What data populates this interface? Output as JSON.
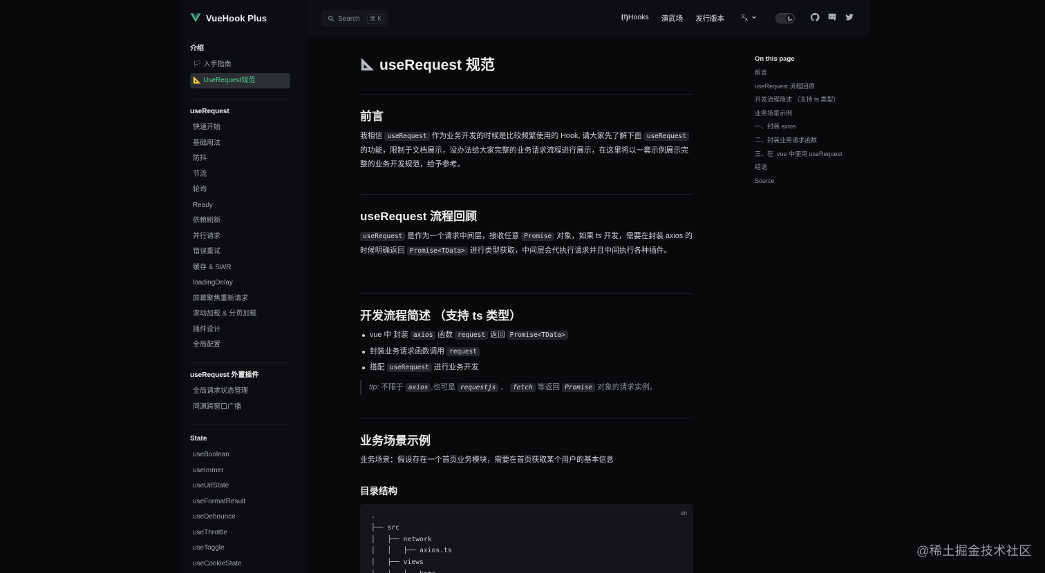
{
  "navbar": {
    "title": "VueHook Plus",
    "search_label": "Search",
    "search_kbd": "⌘ K",
    "links": [
      "⦗f⦘Hooks",
      "演武场",
      "发行版本"
    ],
    "lang_icon": "translate-icon",
    "icons": [
      "github-icon",
      "discord-icon",
      "twitter-icon"
    ]
  },
  "sidebar": {
    "groups": [
      {
        "title": "介绍",
        "items": [
          "🏳 入手指南",
          "📐 UseRequest规范"
        ]
      },
      {
        "title": "useRequest",
        "items": [
          "快速开始",
          "基础用法",
          "防抖",
          "节流",
          "轮询",
          "Ready",
          "依赖刷新",
          "并行请求",
          "错误重试",
          "缓存 & SWR",
          "loadingDelay",
          "屏幕聚焦重新请求",
          "滚动加载 & 分页加载",
          "插件设计",
          "全局配置"
        ]
      },
      {
        "title": "useRequest 外置插件",
        "items": [
          "全局请求状态管理",
          "同源跨窗口广播"
        ]
      },
      {
        "title": "State",
        "items": [
          "useBoolean",
          "useImmer",
          "useUrlState",
          "useFormatResult",
          "useDebounce",
          "useThrottle",
          "useToggle",
          "useCookieState"
        ]
      }
    ],
    "active_item": "📐 UseRequest规范"
  },
  "content": {
    "title": "useRequest 规范",
    "title_icon": "triangular-ruler-icon",
    "sections": {
      "s1_title": "前言",
      "s1_p": [
        "我相信 ",
        "useRequest",
        " 作为业务开发的时候是比较频繁使用的 Hook, 请大家先了解下面 ",
        "useRequest",
        " 的功能，限制于文档展示，没办法给大家完整的业务请求流程进行展示，在这里将以一套示例展示完整的业务开发规范，给予参考。"
      ],
      "s2_title": "useRequest 流程回顾",
      "s2_p": [
        "useRequest",
        " 是作为一个请求中间层，接收任意 ",
        "Promise",
        " 对象，如果 ts 开发，需要在封装 axios 的时候明确返回 ",
        "Promise<TData>",
        " 进行类型获取，中间层会代执行请求并且中间执行各种插件。"
      ],
      "s3_title": "开发流程简述 （支持 ts 类型）",
      "s3_list": [
        [
          "vue 中 封装 ",
          "axios",
          " 函数 ",
          "request",
          " 返回 ",
          "Promise<TData>"
        ],
        [
          "封装业务请求函数调用 ",
          "request"
        ],
        [
          "搭配 ",
          "useRequest",
          " 进行业务开发"
        ]
      ],
      "tip": [
        "tip:",
        " 不限于 ",
        "axios",
        ",也可是 ",
        "requestjs",
        " 、 ",
        "fetch",
        " 等返回 ",
        "Promise",
        " 对象的请求实例。"
      ],
      "s4_title": "业务场景示例",
      "s4_p": "业务场景：假设存在一个首页业务模块，需要在首页获取某个用户的基本信息",
      "s5_title": "目录结构",
      "code_lang": "sh",
      "code": ".\n├── src\n│   ├── network\n│   │   ├── axios.ts\n│   ├── views\n│   │   ├── home"
    }
  },
  "toc": {
    "title": "On this page",
    "items": [
      "前言",
      "useRequest 流程回顾",
      "开发流程简述 （支持 ts 类型）",
      "业务场景示例",
      "一、封装 axios",
      "二、封装业务请求函数",
      "三、在 .vue 中使用 useRequest",
      "结语",
      "Source"
    ]
  },
  "watermark": "@稀土掘金技术社区",
  "colors": {
    "accent": "#4ccf8a",
    "background": "#08090b",
    "code_bg": "#23252a"
  }
}
